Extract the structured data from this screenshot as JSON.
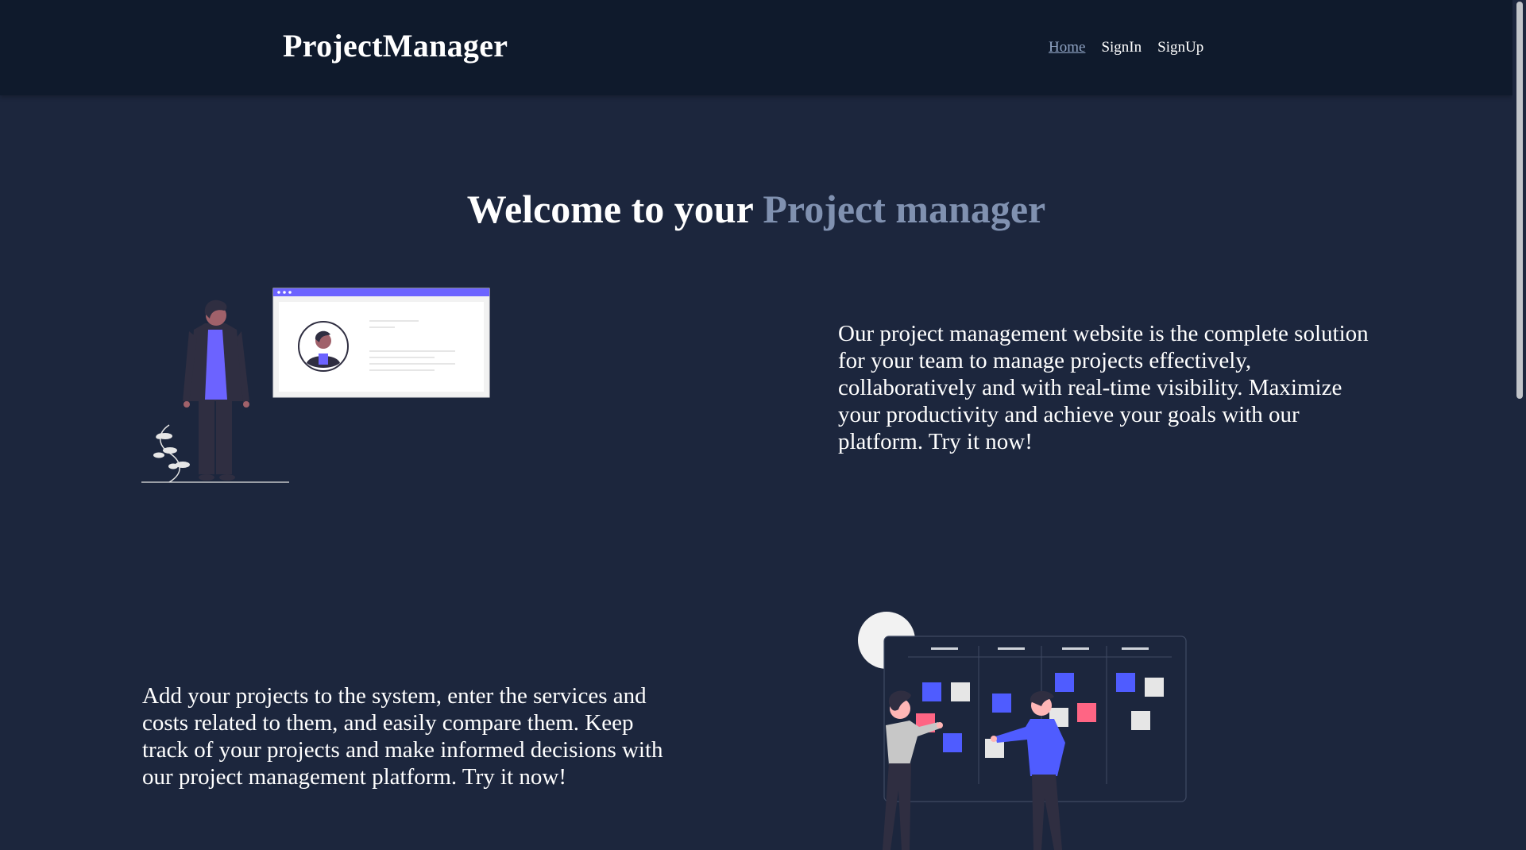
{
  "navbar": {
    "brand": "ProjectManager",
    "links": [
      {
        "label": "Home",
        "active": true
      },
      {
        "label": "SignIn",
        "active": false
      },
      {
        "label": "SignUp",
        "active": false
      }
    ]
  },
  "hero": {
    "title_prefix": "Welcome to your",
    "title_accent": "Project manager"
  },
  "sections": [
    {
      "text": "Our project management website is the complete solution for your team to manage projects effectively, collaboratively and with real-time visibility. Maximize your productivity and achieve your goals with our platform. Try it now!",
      "illustration": "profile-illustration"
    },
    {
      "text": "Add your projects to the system, enter the services and costs related to them, and easily compare them. Keep track of your projects and make informed decisions with our project management platform. Try it now!",
      "illustration": "kanban-board-illustration"
    }
  ],
  "colors": {
    "background": "#1c263d",
    "navbar": "#0f1a2c",
    "accent": "#8091b0",
    "purple": "#6c63ff",
    "blue": "#4f5cff",
    "pink": "#ff6584"
  }
}
